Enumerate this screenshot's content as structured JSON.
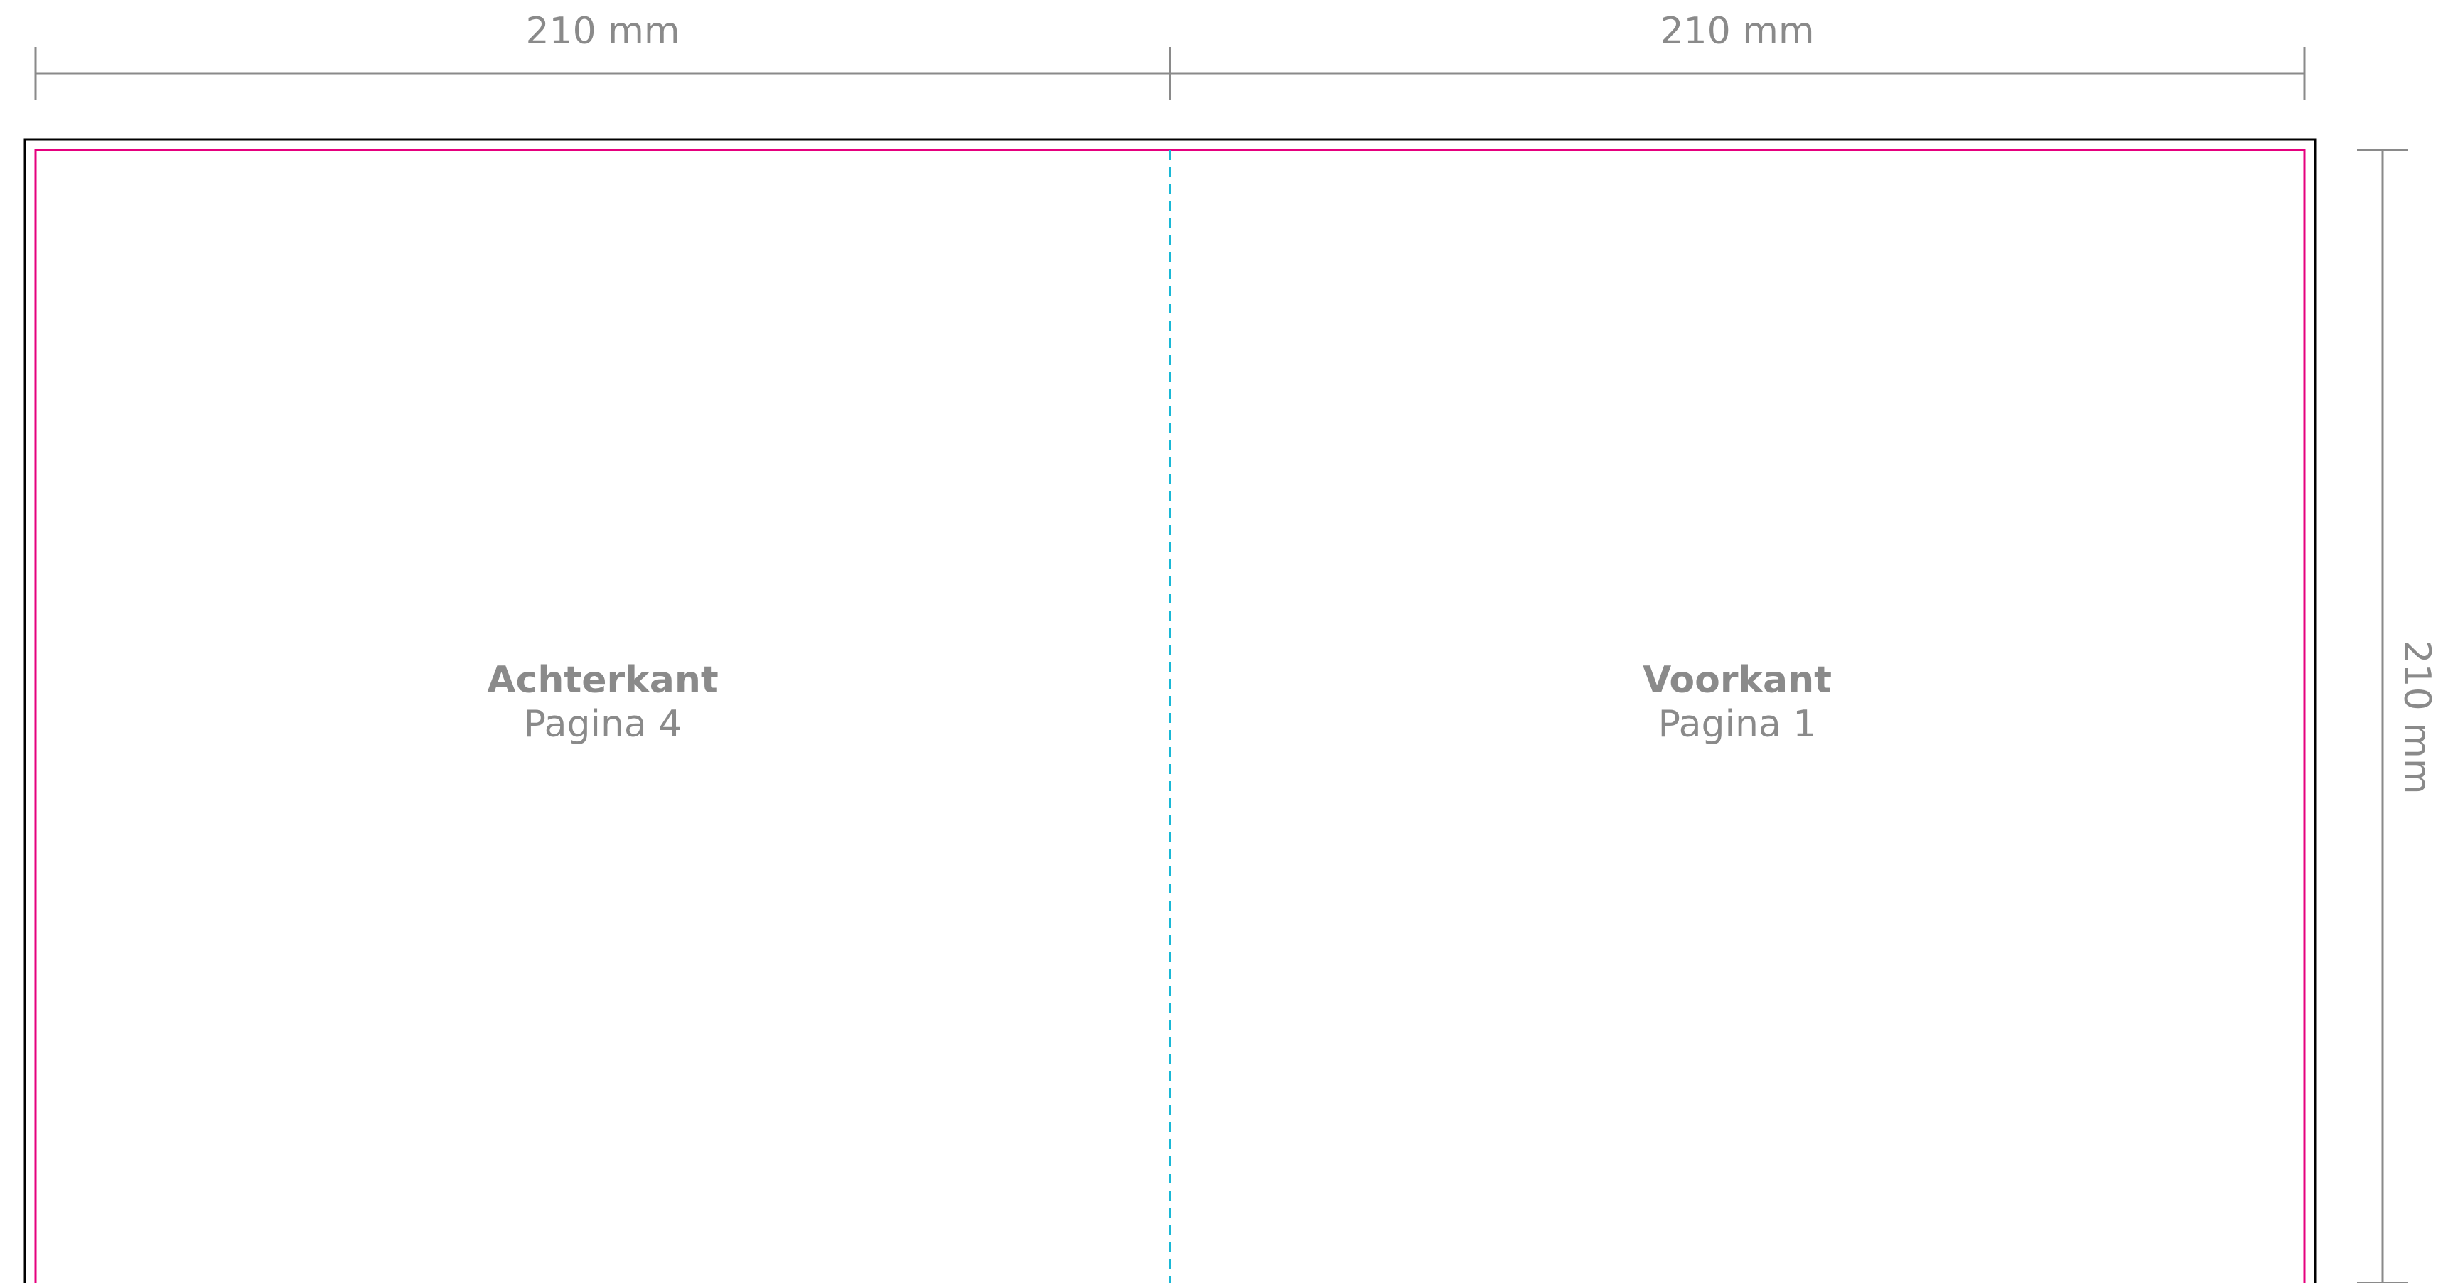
{
  "dimensions": {
    "top_left_width": "210 mm",
    "top_right_width": "210 mm",
    "right_height": "210 mm"
  },
  "panels": [
    {
      "title": "Achterkant",
      "subtitle": "Pagina 4"
    },
    {
      "title": "Voorkant",
      "subtitle": "Pagina 1"
    }
  ],
  "colors": {
    "trim_outline": "#000000",
    "safe_zone": "#e5007e",
    "fold_line": "#19b8d6",
    "dimension": "#8a8a8a"
  }
}
